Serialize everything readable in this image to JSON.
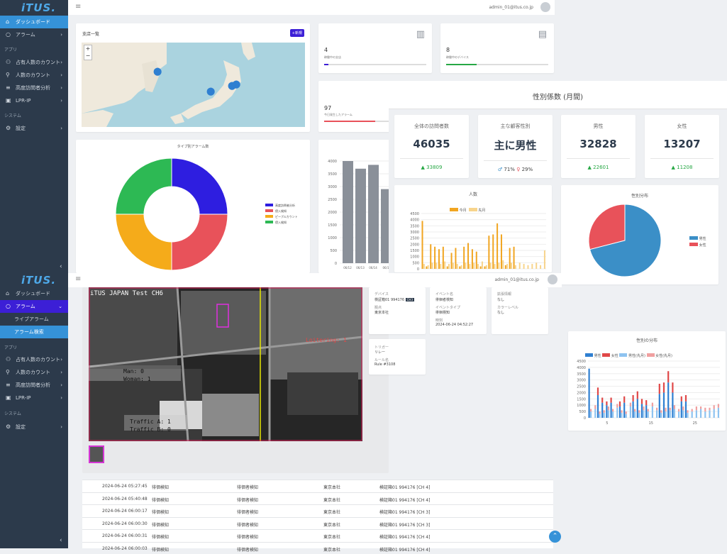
{
  "app": {
    "logo": "iTUS.",
    "user": "admin_01@itus.co.jp"
  },
  "top_sidebar": {
    "items": [
      {
        "label": "ダッシュボード",
        "icon": "dashboard-icon",
        "active": true
      },
      {
        "label": "アラーム",
        "icon": "bell-icon"
      }
    ],
    "section_app": "アプリ",
    "app_items": [
      {
        "label": "占有人数のカウント",
        "icon": "people-icon"
      },
      {
        "label": "人数のカウント",
        "icon": "counter-icon"
      },
      {
        "label": "高度訪問者分析",
        "icon": "analytics-icon"
      },
      {
        "label": "LPR-IP",
        "icon": "camera-icon"
      }
    ],
    "section_system": "システム",
    "system_items": [
      {
        "label": "設定",
        "icon": "gear-icon"
      }
    ]
  },
  "map_card": {
    "title": "支店一覧",
    "button": "+新規"
  },
  "stat_cards": [
    {
      "value": "4",
      "label": "稼働中の支店",
      "color": "#3c1fd6"
    },
    {
      "value": "8",
      "label": "稼働中のデバイス",
      "color": "#27a845"
    },
    {
      "value": "97",
      "label": "今日発生したアラーム",
      "color": "#e8525a"
    }
  ],
  "donut": {
    "title": "タイプ別アラーム数",
    "legend": [
      "高度訪問者分析",
      "侵入検知",
      "ピープルカウント",
      "侵入検知"
    ]
  },
  "bar_small": {
    "yticks": [
      "4000",
      "3500",
      "3000",
      "2500",
      "2000",
      "1500",
      "1000",
      "500",
      "0"
    ],
    "xticks": [
      "06/12",
      "06/13",
      "06/14",
      "06/1"
    ]
  },
  "gender_panel": {
    "title": "性別係数 (月間)",
    "kpis": [
      {
        "label": "全体の訪問者数",
        "value": "46035",
        "sub": "33809"
      },
      {
        "label": "主な顧客性別",
        "value": "主に男性",
        "male_pct": "71%",
        "female_pct": "29%"
      },
      {
        "label": "男性",
        "value": "32828",
        "sub": "22601"
      },
      {
        "label": "女性",
        "value": "13207",
        "sub": "11208"
      }
    ],
    "people_chart": {
      "title": "人数",
      "legend": [
        "今月",
        "先月"
      ],
      "yticks": [
        "4500",
        "4000",
        "3500",
        "3000",
        "2500",
        "2000",
        "1500",
        "1000",
        "500",
        "0"
      ]
    },
    "pie": {
      "title": "性別分布",
      "legend": [
        "男性",
        "女性"
      ]
    },
    "gender_bar": {
      "title": "性別の分布",
      "legend": [
        "男性",
        "女性",
        "男性(先月)",
        "女性(先月)"
      ],
      "yticks": [
        "4500",
        "4000",
        "3500",
        "3000",
        "2500",
        "2000",
        "1500",
        "1000",
        "500",
        "0"
      ],
      "xticks": [
        "5",
        "15",
        "25"
      ]
    }
  },
  "chart_data": [
    {
      "type": "pie",
      "title": "タイプ別アラーム数",
      "categories": [
        "高度訪問者分析",
        "侵入検知",
        "ピープルカウント",
        "侵入検知"
      ],
      "values": [
        25,
        25,
        25,
        25
      ],
      "colors": [
        "#2e1ee0",
        "#e8525a",
        "#f5ab1a",
        "#2db954"
      ]
    },
    {
      "type": "bar",
      "categories": [
        "06/12",
        "06/13",
        "06/14",
        "06/1"
      ],
      "values": [
        4000,
        3700,
        3850,
        2900
      ],
      "ylim": [
        0,
        4000
      ]
    },
    {
      "type": "bar",
      "title": "人数",
      "series": [
        {
          "name": "今月",
          "values": [
            3900,
            200,
            2000,
            1800,
            1600,
            1800,
            200,
            1300,
            1700,
            200,
            1800,
            2100,
            1600,
            1400,
            200,
            200,
            2700,
            2800,
            3700,
            2800,
            300,
            1700,
            1800,
            0,
            0,
            0,
            0,
            0,
            0,
            0
          ]
        },
        {
          "name": "先月",
          "values": [
            400,
            300,
            500,
            500,
            400,
            600,
            400,
            500,
            400,
            300,
            500,
            400,
            500,
            400,
            600,
            300,
            500,
            400,
            500,
            700,
            400,
            500,
            300,
            500,
            400,
            300,
            400,
            500,
            300,
            1500
          ]
        }
      ],
      "ylim": [
        0,
        4500
      ]
    },
    {
      "type": "pie",
      "title": "性別分布",
      "categories": [
        "男性",
        "女性"
      ],
      "values": [
        71,
        29
      ],
      "colors": [
        "#3b8fc7",
        "#e8525a"
      ]
    },
    {
      "type": "bar",
      "title": "性別の分布",
      "series": [
        {
          "name": "男性",
          "values": [
            3900,
            0,
            1800,
            1200,
            1000,
            1200,
            0,
            900,
            1200,
            0,
            1300,
            1500,
            1100,
            1000,
            0,
            0,
            1900,
            2000,
            2800,
            2000,
            0,
            1300,
            1300,
            0,
            0,
            0,
            0,
            0,
            0,
            0
          ]
        },
        {
          "name": "女性",
          "values": [
            0,
            0,
            600,
            400,
            300,
            400,
            0,
            400,
            500,
            0,
            500,
            600,
            400,
            400,
            0,
            0,
            800,
            800,
            900,
            800,
            0,
            400,
            500,
            0,
            0,
            0,
            0,
            0,
            0,
            0
          ]
        },
        {
          "name": "男性(先月)",
          "values": [
            500,
            700,
            300,
            400,
            600,
            500,
            800,
            400,
            300,
            900,
            500,
            400,
            600,
            500,
            900,
            600,
            400,
            500,
            600,
            700,
            500,
            600,
            400,
            500,
            600,
            700,
            500,
            600,
            700,
            800
          ]
        },
        {
          "name": "女性(先月)",
          "values": [
            200,
            300,
            200,
            200,
            300,
            200,
            300,
            200,
            200,
            300,
            200,
            200,
            300,
            200,
            300,
            200,
            200,
            300,
            200,
            300,
            200,
            300,
            200,
            200,
            300,
            200,
            300,
            200,
            300,
            300
          ]
        }
      ],
      "ylim": [
        0,
        4500
      ]
    }
  ],
  "bottom_sidebar": {
    "items": [
      {
        "label": "ダッシュボード",
        "icon": "dashboard-icon"
      },
      {
        "label": "アラーム",
        "icon": "bell-icon",
        "active": true
      }
    ],
    "sub_items": [
      {
        "label": "ライブアラーム"
      },
      {
        "label": "アラーム検索",
        "active": true
      }
    ],
    "section_app": "アプリ",
    "app_items": [
      {
        "label": "占有人数のカウント",
        "icon": "people-icon"
      },
      {
        "label": "人数のカウント",
        "icon": "counter-icon"
      },
      {
        "label": "高度訪問者分析",
        "icon": "analytics-icon"
      },
      {
        "label": "LPR-IP",
        "icon": "camera-icon"
      }
    ],
    "section_system": "システム",
    "system_items": [
      {
        "label": "設定",
        "icon": "gear-icon"
      }
    ]
  },
  "camera": {
    "osd": "iTUS JAPAN Test CH6",
    "loitering": "Loitering: 1",
    "man": "Man: 0",
    "woman": "Woman: 1",
    "traffic_a": "Traffic A: 1",
    "traffic_b": "Traffic B: 0"
  },
  "alarm_detail": {
    "device_label": "デバイス",
    "device": "検証箱01 994176",
    "device_ch": "CH3",
    "site_label": "拠点",
    "site": "東京本社",
    "event_label": "イベント名",
    "event": "徘徊者検知",
    "event_type_label": "イベントタイプ",
    "event_type": "徘徊検知",
    "time_label": "時刻",
    "time": "2024-06-24 04:52:27",
    "extra_label": "拡張情報",
    "extra": "なし",
    "color_label": "カラーレベル",
    "color": "なし",
    "trigger_label": "トリガー",
    "trigger": "リレー",
    "rule_label": "ルール名",
    "rule": "Rule #3108"
  },
  "alarm_rows": [
    {
      "time": "2024-06-24 05:27:45",
      "type": "徘徊検知",
      "event": "徘徊者検知",
      "site": "東京本社",
      "device": "検証箱01 994176 [CH 4]"
    },
    {
      "time": "2024-06-24 05:40:48",
      "type": "徘徊検知",
      "event": "徘徊者検知",
      "site": "東京本社",
      "device": "検証箱01 994176 [CH 4]"
    },
    {
      "time": "2024-06-24 06:00:17",
      "type": "徘徊検知",
      "event": "徘徊者検知",
      "site": "東京本社",
      "device": "検証箱01 994176 [CH 3]"
    },
    {
      "time": "2024-06-24 06:00:30",
      "type": "徘徊検知",
      "event": "徘徊者検知",
      "site": "東京本社",
      "device": "検証箱01 994176 [CH 3]"
    },
    {
      "time": "2024-06-24 06:00:31",
      "type": "徘徊検知",
      "event": "徘徊者検知",
      "site": "東京本社",
      "device": "検証箱01 994176 [CH 4]"
    },
    {
      "time": "2024-06-24 06:00:03",
      "type": "徘徊検知",
      "event": "徘徊者検知",
      "site": "東京本社",
      "device": "検証箱01 994176 [CH 4]"
    }
  ]
}
